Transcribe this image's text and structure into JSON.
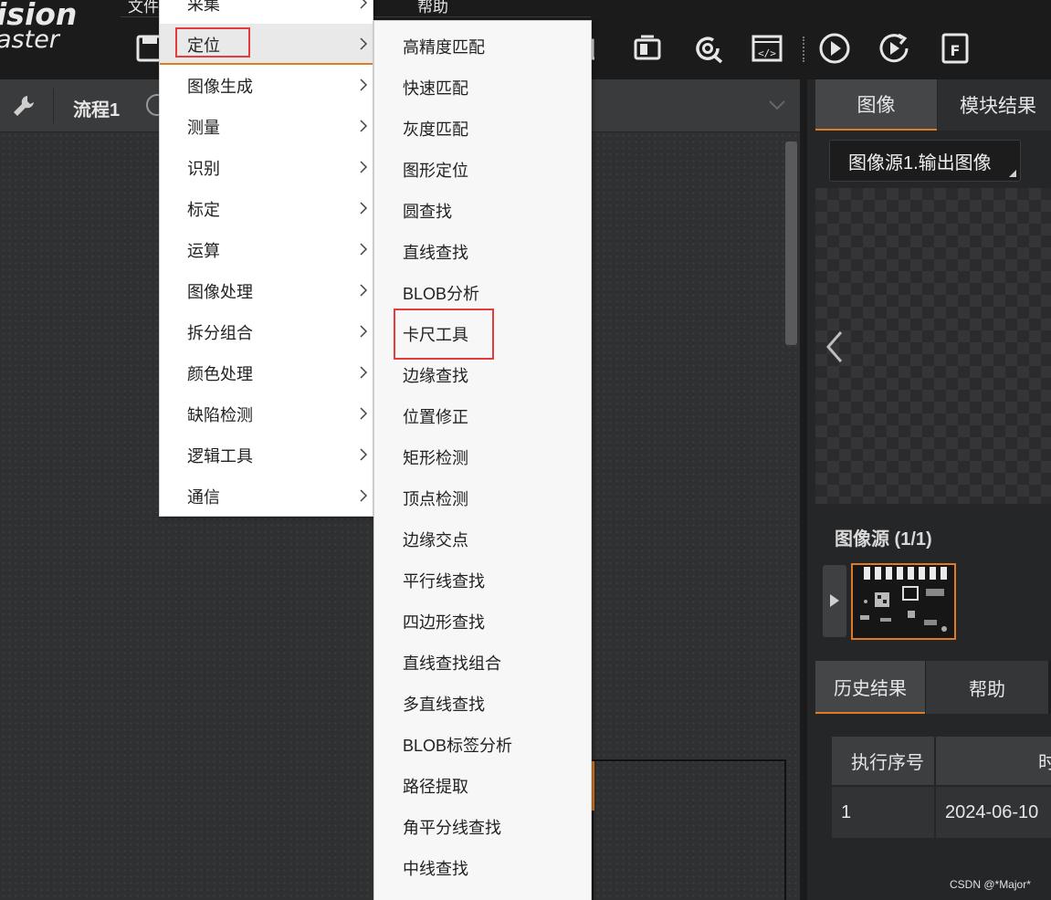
{
  "app": {
    "logo_line1": "ision",
    "logo_line2": "aster",
    "menubar": [
      "文件",
      "帮助"
    ]
  },
  "toolbar": {
    "icons": [
      "save-icon",
      "ocr-icon",
      "device-icon",
      "camera-refresh-icon",
      "script-icon",
      "run-once-icon",
      "run-loop-icon",
      "formula-icon"
    ]
  },
  "process": {
    "tab_label": "流程1"
  },
  "menu_level1": {
    "items": [
      {
        "label": "采集"
      },
      {
        "label": "定位"
      },
      {
        "label": "图像生成"
      },
      {
        "label": "测量"
      },
      {
        "label": "识别"
      },
      {
        "label": "标定"
      },
      {
        "label": "运算"
      },
      {
        "label": "图像处理"
      },
      {
        "label": "拆分组合"
      },
      {
        "label": "颜色处理"
      },
      {
        "label": "缺陷检测"
      },
      {
        "label": "逻辑工具"
      },
      {
        "label": "通信"
      }
    ],
    "active": "定位"
  },
  "menu_level2": {
    "items": [
      {
        "label": "高精度匹配"
      },
      {
        "label": "快速匹配"
      },
      {
        "label": "灰度匹配"
      },
      {
        "label": "图形定位"
      },
      {
        "label": "圆查找"
      },
      {
        "label": "直线查找"
      },
      {
        "label": "BLOB分析"
      },
      {
        "label": "卡尺工具"
      },
      {
        "label": "边缘查找"
      },
      {
        "label": "位置修正"
      },
      {
        "label": "矩形检测"
      },
      {
        "label": "顶点检测"
      },
      {
        "label": "边缘交点"
      },
      {
        "label": "平行线查找"
      },
      {
        "label": "四边形查找"
      },
      {
        "label": "直线查找组合"
      },
      {
        "label": "多直线查找"
      },
      {
        "label": "BLOB标签分析"
      },
      {
        "label": "路径提取"
      },
      {
        "label": "角平分线查找"
      },
      {
        "label": "中线查找"
      }
    ],
    "highlighted": "卡尺工具"
  },
  "right_panel": {
    "tabs": {
      "image": "图像",
      "module_result": "模块结果"
    },
    "image_source_select": "图像源1.输出图像",
    "image_source_count": "图像源 (1/1)",
    "bottom_tabs": {
      "history": "历史结果",
      "help": "帮助"
    },
    "history_table": {
      "headers": [
        "执行序号",
        "时"
      ],
      "rows": [
        [
          "1",
          "2024-06-10"
        ]
      ]
    }
  },
  "watermark": "CSDN @*Major*",
  "colors": {
    "accent": "#e07b25",
    "highlight_box": "#e63b3b",
    "menu_bg": "#ffffff",
    "panel_bg": "#252627"
  }
}
